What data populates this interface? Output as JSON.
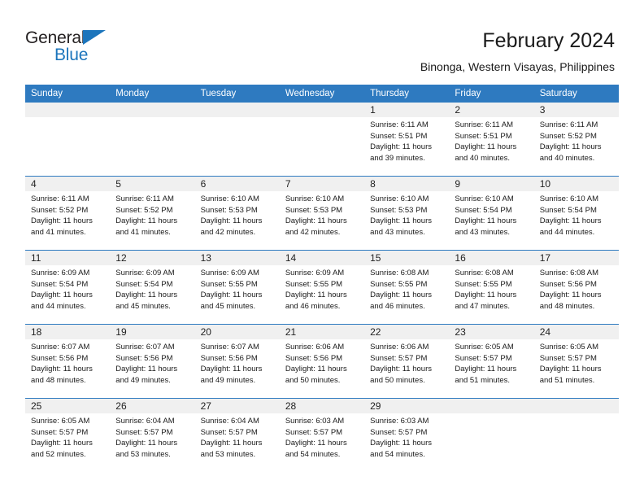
{
  "brand": {
    "name_top": "General",
    "name_bottom": "Blue",
    "accent_color": "#1c75bc"
  },
  "header": {
    "title": "February 2024",
    "subtitle": "Binonga, Western Visayas, Philippines"
  },
  "theme": {
    "header_row_bg": "#2e7ac0",
    "daynum_bg": "#f0f0f0",
    "cell_bg": "#ffffff",
    "text_color": "#1a1a1a"
  },
  "calendar": {
    "weekday_headers": [
      "Sunday",
      "Monday",
      "Tuesday",
      "Wednesday",
      "Thursday",
      "Friday",
      "Saturday"
    ],
    "labels": {
      "sunrise": "Sunrise:",
      "sunset": "Sunset:",
      "daylight": "Daylight:"
    },
    "weeks": [
      [
        {
          "day": "",
          "sunrise": "",
          "sunset": "",
          "daylight_line1": "",
          "daylight_line2": ""
        },
        {
          "day": "",
          "sunrise": "",
          "sunset": "",
          "daylight_line1": "",
          "daylight_line2": ""
        },
        {
          "day": "",
          "sunrise": "",
          "sunset": "",
          "daylight_line1": "",
          "daylight_line2": ""
        },
        {
          "day": "",
          "sunrise": "",
          "sunset": "",
          "daylight_line1": "",
          "daylight_line2": ""
        },
        {
          "day": "1",
          "sunrise": "Sunrise: 6:11 AM",
          "sunset": "Sunset: 5:51 PM",
          "daylight_line1": "Daylight: 11 hours",
          "daylight_line2": "and 39 minutes."
        },
        {
          "day": "2",
          "sunrise": "Sunrise: 6:11 AM",
          "sunset": "Sunset: 5:51 PM",
          "daylight_line1": "Daylight: 11 hours",
          "daylight_line2": "and 40 minutes."
        },
        {
          "day": "3",
          "sunrise": "Sunrise: 6:11 AM",
          "sunset": "Sunset: 5:52 PM",
          "daylight_line1": "Daylight: 11 hours",
          "daylight_line2": "and 40 minutes."
        }
      ],
      [
        {
          "day": "4",
          "sunrise": "Sunrise: 6:11 AM",
          "sunset": "Sunset: 5:52 PM",
          "daylight_line1": "Daylight: 11 hours",
          "daylight_line2": "and 41 minutes."
        },
        {
          "day": "5",
          "sunrise": "Sunrise: 6:11 AM",
          "sunset": "Sunset: 5:52 PM",
          "daylight_line1": "Daylight: 11 hours",
          "daylight_line2": "and 41 minutes."
        },
        {
          "day": "6",
          "sunrise": "Sunrise: 6:10 AM",
          "sunset": "Sunset: 5:53 PM",
          "daylight_line1": "Daylight: 11 hours",
          "daylight_line2": "and 42 minutes."
        },
        {
          "day": "7",
          "sunrise": "Sunrise: 6:10 AM",
          "sunset": "Sunset: 5:53 PM",
          "daylight_line1": "Daylight: 11 hours",
          "daylight_line2": "and 42 minutes."
        },
        {
          "day": "8",
          "sunrise": "Sunrise: 6:10 AM",
          "sunset": "Sunset: 5:53 PM",
          "daylight_line1": "Daylight: 11 hours",
          "daylight_line2": "and 43 minutes."
        },
        {
          "day": "9",
          "sunrise": "Sunrise: 6:10 AM",
          "sunset": "Sunset: 5:54 PM",
          "daylight_line1": "Daylight: 11 hours",
          "daylight_line2": "and 43 minutes."
        },
        {
          "day": "10",
          "sunrise": "Sunrise: 6:10 AM",
          "sunset": "Sunset: 5:54 PM",
          "daylight_line1": "Daylight: 11 hours",
          "daylight_line2": "and 44 minutes."
        }
      ],
      [
        {
          "day": "11",
          "sunrise": "Sunrise: 6:09 AM",
          "sunset": "Sunset: 5:54 PM",
          "daylight_line1": "Daylight: 11 hours",
          "daylight_line2": "and 44 minutes."
        },
        {
          "day": "12",
          "sunrise": "Sunrise: 6:09 AM",
          "sunset": "Sunset: 5:54 PM",
          "daylight_line1": "Daylight: 11 hours",
          "daylight_line2": "and 45 minutes."
        },
        {
          "day": "13",
          "sunrise": "Sunrise: 6:09 AM",
          "sunset": "Sunset: 5:55 PM",
          "daylight_line1": "Daylight: 11 hours",
          "daylight_line2": "and 45 minutes."
        },
        {
          "day": "14",
          "sunrise": "Sunrise: 6:09 AM",
          "sunset": "Sunset: 5:55 PM",
          "daylight_line1": "Daylight: 11 hours",
          "daylight_line2": "and 46 minutes."
        },
        {
          "day": "15",
          "sunrise": "Sunrise: 6:08 AM",
          "sunset": "Sunset: 5:55 PM",
          "daylight_line1": "Daylight: 11 hours",
          "daylight_line2": "and 46 minutes."
        },
        {
          "day": "16",
          "sunrise": "Sunrise: 6:08 AM",
          "sunset": "Sunset: 5:55 PM",
          "daylight_line1": "Daylight: 11 hours",
          "daylight_line2": "and 47 minutes."
        },
        {
          "day": "17",
          "sunrise": "Sunrise: 6:08 AM",
          "sunset": "Sunset: 5:56 PM",
          "daylight_line1": "Daylight: 11 hours",
          "daylight_line2": "and 48 minutes."
        }
      ],
      [
        {
          "day": "18",
          "sunrise": "Sunrise: 6:07 AM",
          "sunset": "Sunset: 5:56 PM",
          "daylight_line1": "Daylight: 11 hours",
          "daylight_line2": "and 48 minutes."
        },
        {
          "day": "19",
          "sunrise": "Sunrise: 6:07 AM",
          "sunset": "Sunset: 5:56 PM",
          "daylight_line1": "Daylight: 11 hours",
          "daylight_line2": "and 49 minutes."
        },
        {
          "day": "20",
          "sunrise": "Sunrise: 6:07 AM",
          "sunset": "Sunset: 5:56 PM",
          "daylight_line1": "Daylight: 11 hours",
          "daylight_line2": "and 49 minutes."
        },
        {
          "day": "21",
          "sunrise": "Sunrise: 6:06 AM",
          "sunset": "Sunset: 5:56 PM",
          "daylight_line1": "Daylight: 11 hours",
          "daylight_line2": "and 50 minutes."
        },
        {
          "day": "22",
          "sunrise": "Sunrise: 6:06 AM",
          "sunset": "Sunset: 5:57 PM",
          "daylight_line1": "Daylight: 11 hours",
          "daylight_line2": "and 50 minutes."
        },
        {
          "day": "23",
          "sunrise": "Sunrise: 6:05 AM",
          "sunset": "Sunset: 5:57 PM",
          "daylight_line1": "Daylight: 11 hours",
          "daylight_line2": "and 51 minutes."
        },
        {
          "day": "24",
          "sunrise": "Sunrise: 6:05 AM",
          "sunset": "Sunset: 5:57 PM",
          "daylight_line1": "Daylight: 11 hours",
          "daylight_line2": "and 51 minutes."
        }
      ],
      [
        {
          "day": "25",
          "sunrise": "Sunrise: 6:05 AM",
          "sunset": "Sunset: 5:57 PM",
          "daylight_line1": "Daylight: 11 hours",
          "daylight_line2": "and 52 minutes."
        },
        {
          "day": "26",
          "sunrise": "Sunrise: 6:04 AM",
          "sunset": "Sunset: 5:57 PM",
          "daylight_line1": "Daylight: 11 hours",
          "daylight_line2": "and 53 minutes."
        },
        {
          "day": "27",
          "sunrise": "Sunrise: 6:04 AM",
          "sunset": "Sunset: 5:57 PM",
          "daylight_line1": "Daylight: 11 hours",
          "daylight_line2": "and 53 minutes."
        },
        {
          "day": "28",
          "sunrise": "Sunrise: 6:03 AM",
          "sunset": "Sunset: 5:57 PM",
          "daylight_line1": "Daylight: 11 hours",
          "daylight_line2": "and 54 minutes."
        },
        {
          "day": "29",
          "sunrise": "Sunrise: 6:03 AM",
          "sunset": "Sunset: 5:57 PM",
          "daylight_line1": "Daylight: 11 hours",
          "daylight_line2": "and 54 minutes."
        },
        {
          "day": "",
          "sunrise": "",
          "sunset": "",
          "daylight_line1": "",
          "daylight_line2": ""
        },
        {
          "day": "",
          "sunrise": "",
          "sunset": "",
          "daylight_line1": "",
          "daylight_line2": ""
        }
      ]
    ]
  }
}
